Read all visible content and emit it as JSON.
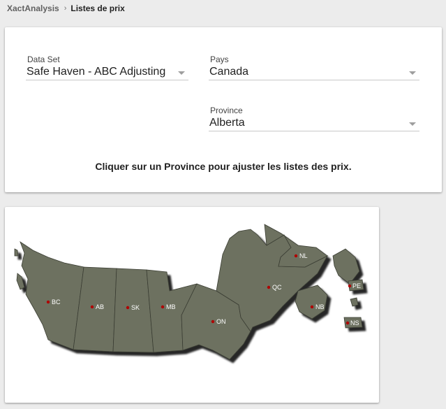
{
  "breadcrumb": {
    "home": "XactAnalysis",
    "separator": "›",
    "current": "Listes de prix"
  },
  "form": {
    "dataset": {
      "label": "Data Set",
      "value": "Safe Haven - ABC Adjusting"
    },
    "country": {
      "label": "Pays",
      "value": "Canada"
    },
    "province": {
      "label": "Province",
      "value": "Alberta"
    },
    "instruction": "Cliquer sur un Province pour ajuster les listes des prix."
  },
  "map": {
    "land_color": "#6d7161",
    "dot_color": "#b00000",
    "provinces": [
      {
        "code": "BC"
      },
      {
        "code": "AB"
      },
      {
        "code": "SK"
      },
      {
        "code": "MB"
      },
      {
        "code": "ON"
      },
      {
        "code": "QC"
      },
      {
        "code": "NL"
      },
      {
        "code": "NB"
      },
      {
        "code": "PE"
      },
      {
        "code": "NS"
      }
    ]
  }
}
